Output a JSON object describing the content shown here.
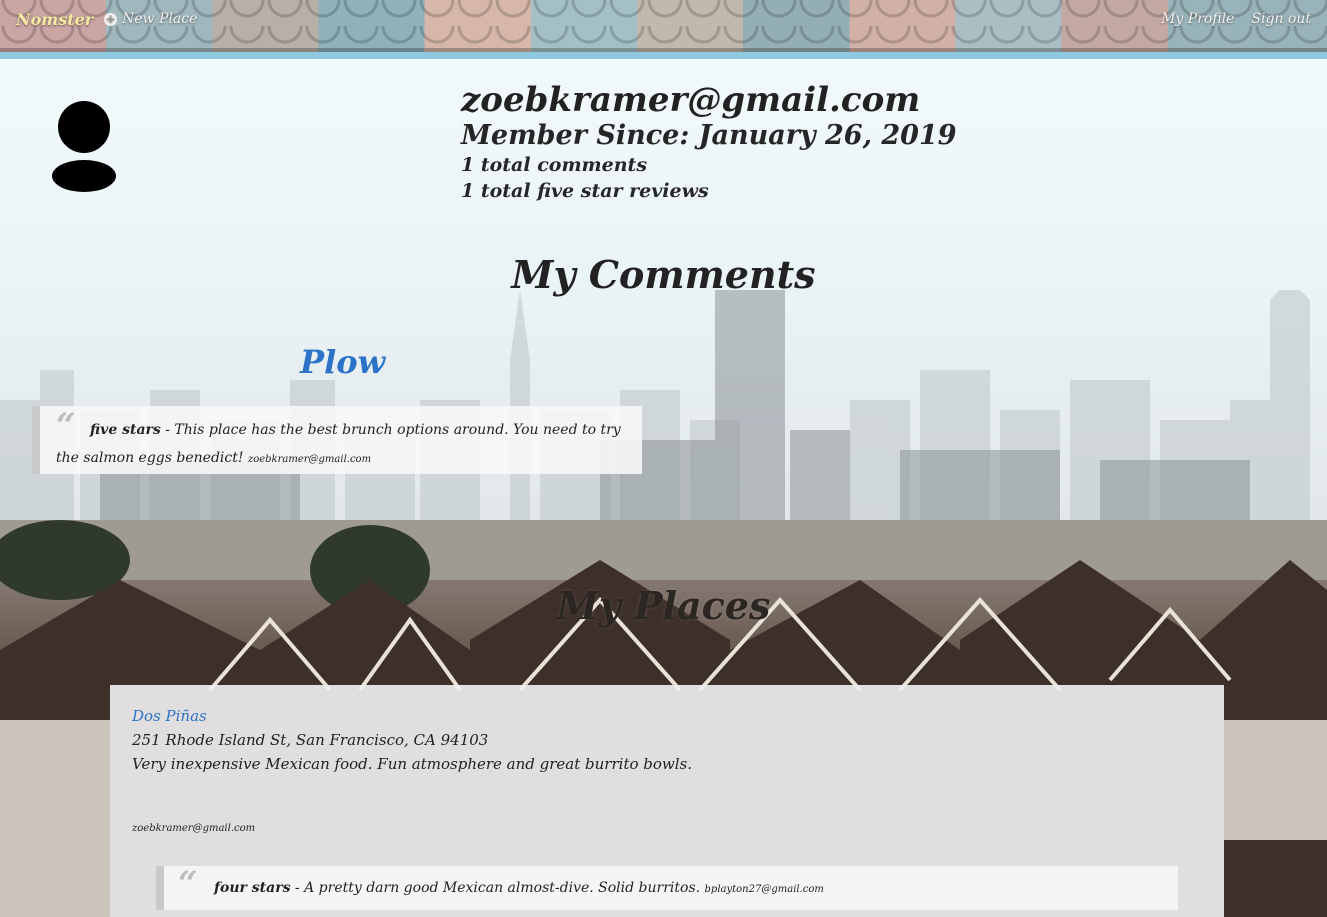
{
  "nav": {
    "brand": "Nomster",
    "new_place": "New Place",
    "my_profile": "My Profile",
    "sign_out": "Sign out"
  },
  "profile": {
    "email": "zoebkramer@gmail.com",
    "member_since": "Member Since: January 26, 2019",
    "total_comments": "1 total comments",
    "total_five_star": "1 total five star reviews"
  },
  "comments_section": {
    "heading": "My Comments",
    "items": [
      {
        "place": "Plow",
        "rating": "five stars",
        "text": " - This place has the best brunch options around. You need to try the salmon eggs benedict! ",
        "user": "zoebkramer@gmail.com"
      }
    ]
  },
  "places_section": {
    "heading": "My Places",
    "items": [
      {
        "name": "Dos Piñas",
        "address": "251 Rhode Island St, San Francisco, CA 94103",
        "description": "Very inexpensive Mexican food. Fun atmosphere and great burrito bowls.",
        "owner": "zoebkramer@gmail.com",
        "comment": {
          "rating": "four stars",
          "text": " - A pretty darn good Mexican almost-dive. Solid burritos. ",
          "user": "bplayton27@gmail.com"
        }
      }
    ]
  },
  "colors": {
    "link_blue": "#2c72c7",
    "nav_stripe": "#8ec9e0",
    "brand_yellow": "#f3e9a0"
  },
  "icons": {
    "new_place": "plus-circle-icon",
    "avatar": "user-silhouette-icon",
    "quote": "quote-mark-icon"
  }
}
